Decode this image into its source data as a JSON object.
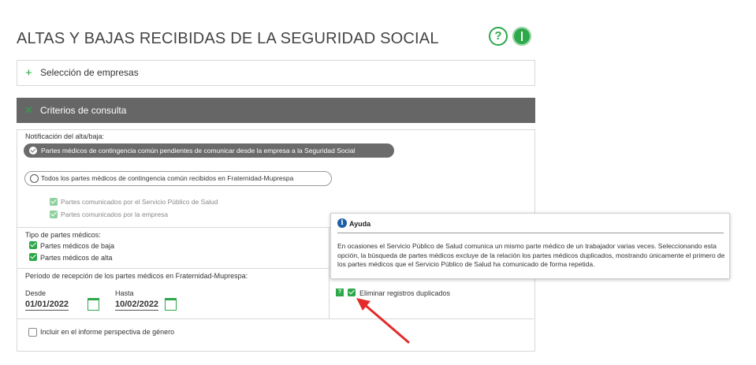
{
  "header": {
    "title": "ALTAS Y BAJAS RECIBIDAS DE LA SEGURIDAD SOCIAL",
    "help_icon": "question-icon",
    "info_icon": "info-icon",
    "accent": "#2da84a"
  },
  "seleccion": {
    "label": "Selección de empresas",
    "icon": "plus-icon"
  },
  "criterios": {
    "label": "Criterios de consulta",
    "icon": "close-icon",
    "notificacion": {
      "label": "Notificación del alta/baja:",
      "option_selected": "Partes médicos de contingencia común pendientes de comunicar desde la empresa a la Seguridad Social",
      "option_other": "Todos los partes médicos de contingencia común recibidos en Fraternidad-Muprespa",
      "sub_options": [
        "Partes comunicados por el Servicio Público de Salud",
        "Partes comunicados por la empresa"
      ]
    },
    "tipo": {
      "label": "Tipo de partes médicos:",
      "options": [
        "Partes médicos de baja",
        "Partes médicos de alta"
      ]
    },
    "periodo": {
      "label": "Período de recepción de los partes médicos en Fraternidad-Muprespa:",
      "desde_label": "Desde",
      "desde_value": "01/01/2022",
      "hasta_label": "Hasta",
      "hasta_value": "10/02/2022"
    },
    "eliminar_label": "Eliminar registros duplicados",
    "genero_label": "Incluir en el informe perspectiva de género"
  },
  "tooltip": {
    "title": "Ayuda",
    "text": "En ocasiones el Servicio Público de Salud comunica un mismo parte médico de un trabajador varias veces. Seleccionando esta opción, la búsqueda de partes médicos excluye de la relación los partes médicos duplicados, mostrando únicamente el primero de los partes médicos que el Servicio Público de Salud ha comunicado de forma repetida."
  },
  "annotation": {
    "arrow_color": "#e32b2b"
  }
}
